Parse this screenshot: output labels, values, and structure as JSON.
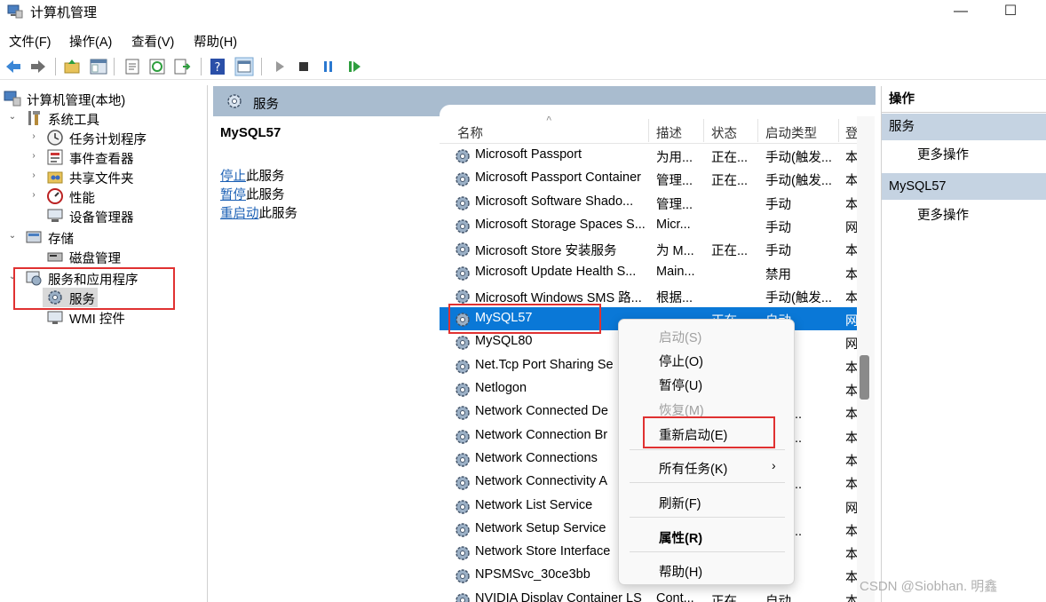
{
  "window": {
    "title": "计算机管理",
    "minimize": "—",
    "maximize": "☐"
  },
  "menu": [
    "文件(F)",
    "操作(A)",
    "查看(V)",
    "帮助(H)"
  ],
  "tree": {
    "root": "计算机管理(本地)",
    "system_tools": "系统工具",
    "task_scheduler": "任务计划程序",
    "event_viewer": "事件查看器",
    "shared_folders": "共享文件夹",
    "performance": "性能",
    "device_manager": "设备管理器",
    "storage": "存储",
    "disk_management": "磁盘管理",
    "services_apps": "服务和应用程序",
    "services": "服务",
    "wmi": "WMI 控件"
  },
  "panel_title": "服务",
  "detail": {
    "service_name": "MySQL57",
    "stop_link": "停止",
    "stop_rest": "此服务",
    "pause_link": "暂停",
    "pause_rest": "此服务",
    "restart_link": "重启动",
    "restart_rest": "此服务"
  },
  "columns": {
    "name": "名称",
    "desc": "描述",
    "status": "状态",
    "startup": "启动类型",
    "logon": "登"
  },
  "rows": [
    {
      "name": "Microsoft Passport",
      "desc": "为用...",
      "status": "正在...",
      "startup": "手动(触发...",
      "logon": "本"
    },
    {
      "name": "Microsoft Passport Container",
      "desc": "管理...",
      "status": "正在...",
      "startup": "手动(触发...",
      "logon": "本"
    },
    {
      "name": "Microsoft Software Shado...",
      "desc": "管理...",
      "status": "",
      "startup": "手动",
      "logon": "本"
    },
    {
      "name": "Microsoft Storage Spaces S...",
      "desc": "Micr...",
      "status": "",
      "startup": "手动",
      "logon": "网"
    },
    {
      "name": "Microsoft Store 安装服务",
      "desc": "为 M...",
      "status": "正在...",
      "startup": "手动",
      "logon": "本"
    },
    {
      "name": "Microsoft Update Health S...",
      "desc": "Main...",
      "status": "",
      "startup": "禁用",
      "logon": "本"
    },
    {
      "name": "Microsoft Windows SMS 路...",
      "desc": "根据...",
      "status": "",
      "startup": "手动(触发...",
      "logon": "本"
    },
    {
      "name": "MySQL57",
      "desc": "",
      "status": "正在...",
      "startup": "自动",
      "logon": "网"
    },
    {
      "name": "MySQL80",
      "desc": "",
      "status": "",
      "startup": "",
      "logon": "网"
    },
    {
      "name": "Net.Tcp Port Sharing Se",
      "desc": "",
      "status": "",
      "startup": "",
      "logon": "本"
    },
    {
      "name": "Netlogon",
      "desc": "",
      "status": "",
      "startup": "",
      "logon": "本"
    },
    {
      "name": "Network Connected De",
      "desc": "",
      "status": "",
      "startup": "触发...",
      "logon": "本"
    },
    {
      "name": "Network Connection Br",
      "desc": "",
      "status": "",
      "startup": "触发...",
      "logon": "本"
    },
    {
      "name": "Network Connections",
      "desc": "",
      "status": "",
      "startup": "",
      "logon": "本"
    },
    {
      "name": "Network Connectivity A",
      "desc": "",
      "status": "",
      "startup": "触发...",
      "logon": "本"
    },
    {
      "name": "Network List Service",
      "desc": "",
      "status": "",
      "startup": "",
      "logon": "网"
    },
    {
      "name": "Network Setup Service",
      "desc": "",
      "status": "",
      "startup": "触发...",
      "logon": "本"
    },
    {
      "name": "Network Store Interface",
      "desc": "",
      "status": "",
      "startup": "",
      "logon": "本"
    },
    {
      "name": "NPSMSvc_30ce3bb",
      "desc": "",
      "status": "",
      "startup": "",
      "logon": "本"
    },
    {
      "name": "NVIDIA Display Container LS",
      "desc": "Cont...",
      "status": "正在...",
      "startup": "自动",
      "logon": "本"
    }
  ],
  "actions": {
    "header": "操作",
    "group1": "服务",
    "group1_more": "更多操作",
    "group2": "MySQL57",
    "group2_more": "更多操作"
  },
  "context_menu": {
    "start": "启动(S)",
    "stop": "停止(O)",
    "pause": "暂停(U)",
    "resume": "恢复(M)",
    "restart": "重新启动(E)",
    "all_tasks": "所有任务(K)",
    "all_tasks_arrow": "›",
    "refresh": "刷新(F)",
    "properties": "属性(R)",
    "help": "帮助(H)"
  },
  "watermark": "CSDN @Siobhan. 明鑫",
  "colors": {
    "selection": "#0a78d7",
    "highlight_box": "#e03131",
    "panel_header": "#a9bccf",
    "actions_header": "#c5d3e2"
  }
}
